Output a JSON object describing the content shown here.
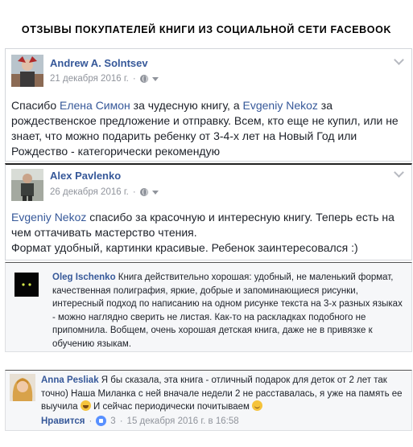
{
  "heading": "ОТЗЫВЫ ПОКУПАТЕЛЕЙ КНИГИ ИЗ СОЦИАЛЬНОЙ СЕТИ FACEBOOK",
  "posts": [
    {
      "author": "Andrew A. Solntsev",
      "date": "21 декабря 2016 г.",
      "text_parts": {
        "a": "Спасибо ",
        "mention1": "Елена Симон",
        "b": " за чудесную книгу, а ",
        "mention2": "Evgeniy Nekoz",
        "c": " за рождественское предложение и отправку. Всем, кто еще не купил, или не знает, что можно подарить ребенку от 3-4-х лет на Новый Год или Рождество - категорически рекомендую"
      }
    },
    {
      "author": "Alex Pavlenko",
      "date": "26 декабря 2016 г.",
      "text_parts": {
        "mention1": "Evgeniy Nekoz",
        "a": " спасибо за красочную и интересную книгу. Теперь есть на чем оттачивать мастерство чтения.",
        "b": "Формат удобный, картинки красивые. Ребенок заинтересовался :)"
      }
    }
  ],
  "comments": [
    {
      "author": "Oleg Ischenko",
      "text": " Книга действительно хорошая: удобный, не маленький формат, качественная полиграфия, яркие, добрые и запоминающиеся рисунки, интересный подход по написанию на одном рисунке текста на 3-х разных языках - можно наглядно сверить не листая. Как-то на раскладках подобного не припомнила. Вобщем, очень хорошая детская книга, даже не в привязке к обучению языкам."
    },
    {
      "author": "Anna Pesliak",
      "text_a": " Я бы сказала, эта книга - отличный подарок для деток от 2 лет так точно) Наша Миланка с ней вначале недели 2 не расставалась, я уже на память ее выучила ",
      "text_b": " И сейчас периодически почитываем ",
      "like_label": "Нравится",
      "like_count": "3",
      "separator": "·",
      "timestamp": "15 декабря 2016 г. в 16:58"
    }
  ],
  "icons": {
    "audience": "globe-icon",
    "menu": "chevron-down-icon",
    "dropdown": "caret-down-icon"
  }
}
